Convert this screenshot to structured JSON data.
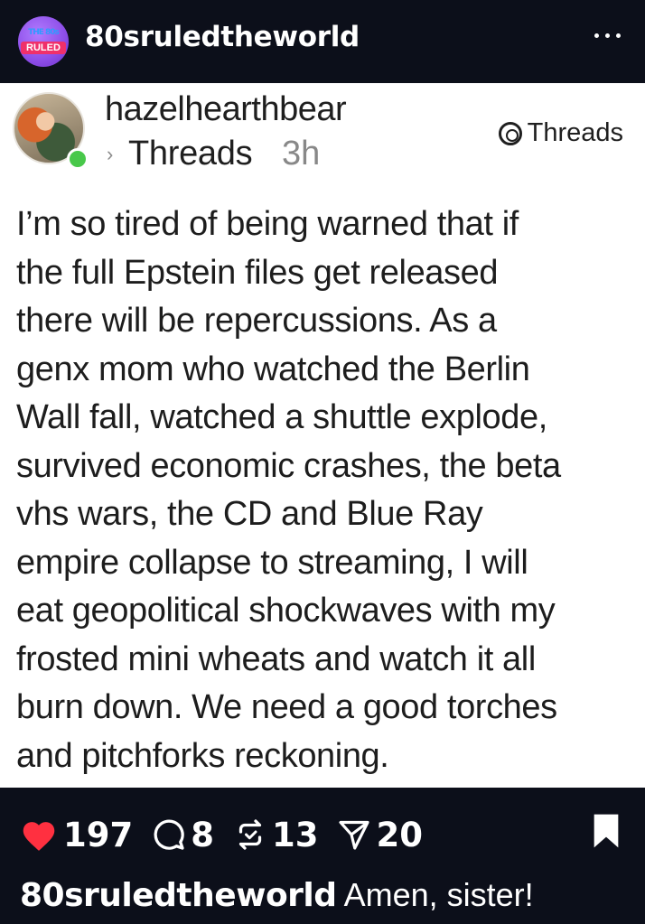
{
  "header": {
    "account_name": "80sruledtheworld",
    "logo_text_top": "THE 80s",
    "logo_text_bar": "RULED"
  },
  "post": {
    "username": "hazelhearthbear",
    "source": "Threads",
    "time": "3h",
    "badge_label": "Threads",
    "lines": [
      "I’m so tired of being warned that if",
      "the full Epstein files get released",
      "there will be repercussions.  As a",
      "genx mom who watched the Berlin",
      "Wall fall, watched a shuttle explode,",
      "survived economic crashes, the beta",
      "vhs wars, the CD and Blue Ray",
      "empire collapse to streaming, I will",
      "eat geopolitical shockwaves with my",
      "frosted mini wheats and watch it all",
      "burn down.  We need a good torches",
      "and pitchforks reckoning."
    ]
  },
  "actions": {
    "likes": "197",
    "comments": "8",
    "reposts": "13",
    "shares": "20"
  },
  "caption": {
    "username": "80sruledtheworld",
    "text": " Amen, sister!"
  },
  "colors": {
    "header_bg": "#0c0f1a",
    "card_bg": "#ffffff",
    "like_red": "#ff3040",
    "online_green": "#48c84a"
  }
}
